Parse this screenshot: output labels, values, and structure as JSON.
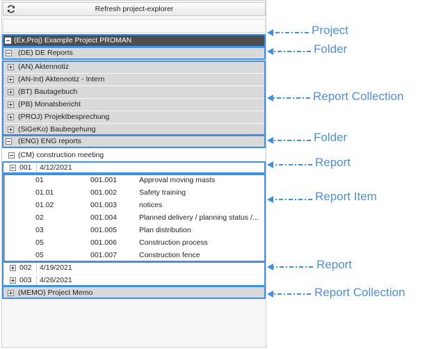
{
  "toolbar": {
    "refresh_label": "Refresh project-explorer",
    "refresh_icon": "refresh-icon"
  },
  "tree": {
    "project": "(Ex.Proj) Example Project PROMAN",
    "folder_de": "(DE) DE Reports",
    "de_collections": [
      "(AN) Aktennotiz",
      "(AN-Int) Aktennotiz - Intern",
      "(BT) Bautagebuch",
      "(PB) Monatsbericht",
      "(PROJ) Projektbesprechung",
      "(SiGeKo) Baubegehung"
    ],
    "folder_eng": "(ENG) ENG reports",
    "collection_cm": "(CM) construction meeting",
    "report_open": {
      "number": "001",
      "date": "4/12/2021"
    },
    "report_items": [
      {
        "pos": "01",
        "id": "001.001",
        "title": "Approval moving masts"
      },
      {
        "pos": "01.01",
        "id": "001.002",
        "title": "Safety training"
      },
      {
        "pos": "01.02",
        "id": "001.003",
        "title": "notices"
      },
      {
        "pos": "02",
        "id": "001.004",
        "title": "Planned delivery / planning status /..."
      },
      {
        "pos": "03",
        "id": "001.005",
        "title": "Plan distribution"
      },
      {
        "pos": "05",
        "id": "001.006",
        "title": "Construction process"
      },
      {
        "pos": "05",
        "id": "001.007",
        "title": "Construction fence"
      }
    ],
    "reports_closed": [
      {
        "number": "002",
        "date": "4/19/2021"
      },
      {
        "number": "003",
        "date": "4/26/2021"
      }
    ],
    "collection_memo": "(MEMO) Project Memo"
  },
  "callouts": {
    "project": "Project",
    "folder_1": "Folder",
    "report_collection_1": "Report Collection",
    "folder_2": "Folder",
    "report_1": "Report",
    "report_item": "Report Item",
    "report_2": "Report",
    "report_collection_2": "Report Collection"
  },
  "colors": {
    "annotation": "#3b8fe8",
    "callout_text": "#4f8fd9",
    "project_row": "#4e4e4e",
    "folder_row": "#d9d9d9"
  }
}
